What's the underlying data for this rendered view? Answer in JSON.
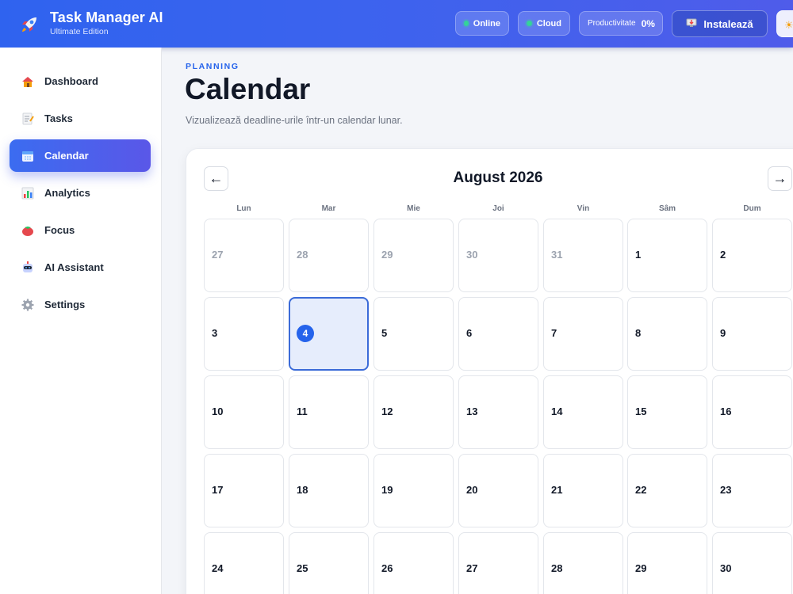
{
  "app": {
    "title": "Task Manager AI",
    "subtitle": "Ultimate Edition",
    "icon": "rocket-icon"
  },
  "header": {
    "online_label": "Online",
    "cloud_label": "Cloud",
    "productivity_label": "Productivitate",
    "productivity_value": "0%",
    "install_label": "Instalează",
    "install_icon": "install-icon",
    "status_color": "#34d399"
  },
  "sidebar": {
    "items": [
      {
        "label": "Dashboard",
        "icon": "house-icon"
      },
      {
        "label": "Tasks",
        "icon": "memo-icon"
      },
      {
        "label": "Calendar",
        "icon": "calendar-icon",
        "active": true
      },
      {
        "label": "Analytics",
        "icon": "bar-chart-icon"
      },
      {
        "label": "Focus",
        "icon": "tomato-icon"
      },
      {
        "label": "AI Assistant",
        "icon": "robot-icon"
      },
      {
        "label": "Settings",
        "icon": "gear-icon"
      }
    ]
  },
  "page": {
    "eyebrow": "PLANNING",
    "title": "Calendar",
    "subtitle": "Vizualizează deadline-urile într-un calendar lunar."
  },
  "calendar": {
    "month_label": "August 2026",
    "prev_label": "←",
    "next_label": "→",
    "weekdays": [
      "Lun",
      "Mar",
      "Mie",
      "Joi",
      "Vin",
      "Sâm",
      "Dum"
    ],
    "today": "4",
    "days": [
      {
        "n": "27",
        "muted": true
      },
      {
        "n": "28",
        "muted": true
      },
      {
        "n": "29",
        "muted": true
      },
      {
        "n": "30",
        "muted": true
      },
      {
        "n": "31",
        "muted": true
      },
      {
        "n": "1"
      },
      {
        "n": "2"
      },
      {
        "n": "3"
      },
      {
        "n": "4",
        "today": true
      },
      {
        "n": "5"
      },
      {
        "n": "6"
      },
      {
        "n": "7"
      },
      {
        "n": "8"
      },
      {
        "n": "9"
      },
      {
        "n": "10"
      },
      {
        "n": "11"
      },
      {
        "n": "12"
      },
      {
        "n": "13"
      },
      {
        "n": "14"
      },
      {
        "n": "15"
      },
      {
        "n": "16"
      },
      {
        "n": "17"
      },
      {
        "n": "18"
      },
      {
        "n": "19"
      },
      {
        "n": "20"
      },
      {
        "n": "21"
      },
      {
        "n": "22"
      },
      {
        "n": "23"
      },
      {
        "n": "24"
      },
      {
        "n": "25"
      },
      {
        "n": "26"
      },
      {
        "n": "27"
      },
      {
        "n": "28"
      },
      {
        "n": "29"
      },
      {
        "n": "30"
      }
    ],
    "accent_color": "#2563eb"
  }
}
